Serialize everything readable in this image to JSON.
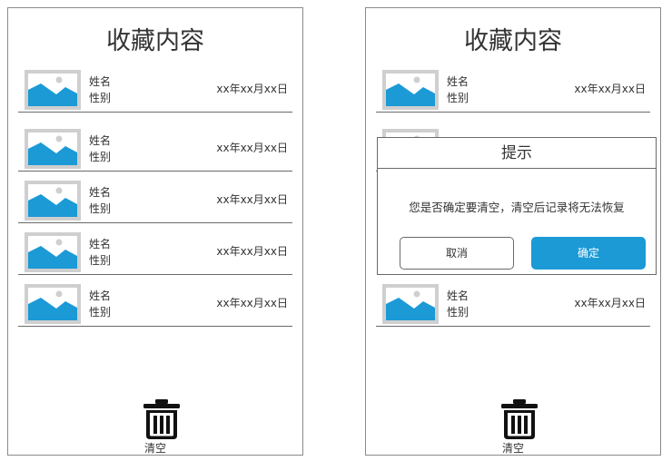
{
  "colors": {
    "accent": "#1b9ad6",
    "thumb_bg": "#cfcfcf",
    "border": "#6a6a6a"
  },
  "left": {
    "title": "收藏内容",
    "items": [
      {
        "name": "姓名",
        "gender": "性别",
        "date": "xx年xx月xx日"
      },
      {
        "name": "姓名",
        "gender": "性别",
        "date": "xx年xx月xx日"
      },
      {
        "name": "姓名",
        "gender": "性别",
        "date": "xx年xx月xx日"
      },
      {
        "name": "姓名",
        "gender": "性别",
        "date": "xx年xx月xx日"
      },
      {
        "name": "姓名",
        "gender": "性别",
        "date": "xx年xx月xx日"
      }
    ],
    "clear_label": "清空",
    "clear_icon": "trash-icon"
  },
  "right": {
    "title": "收藏内容",
    "items": [
      {
        "name": "姓名",
        "gender": "性别",
        "date": "xx年xx月xx日"
      },
      {
        "name": "姓名",
        "gender": "性别",
        "date": "xx年xx月xx日"
      }
    ],
    "clear_label": "清空",
    "dialog": {
      "title": "提示",
      "message": "您是否确定要清空，清空后记录将无法恢复",
      "cancel_label": "取消",
      "confirm_label": "确定"
    }
  }
}
